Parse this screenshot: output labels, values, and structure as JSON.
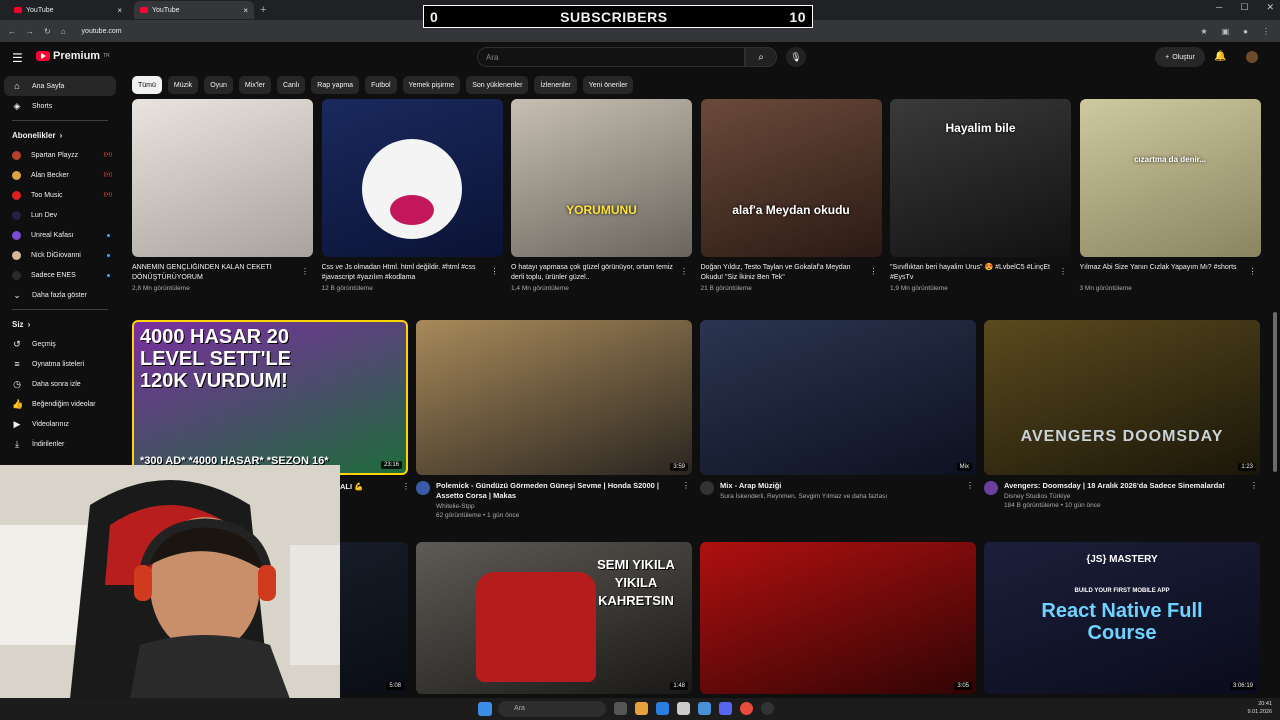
{
  "browser": {
    "tabs": [
      {
        "label": "YouTube"
      },
      {
        "label": "YouTube"
      }
    ],
    "url": "youtube.com"
  },
  "overlay": {
    "left": "0",
    "title": "SUBSCRIBERS",
    "right": "10"
  },
  "masthead": {
    "logo": "Premium",
    "logo_sup": "TR",
    "search_placeholder": "Ara",
    "create_label": "Oluştur"
  },
  "chips": [
    "Tümü",
    "Müzik",
    "Oyun",
    "Mix'ler",
    "Canlı",
    "Rap yapma",
    "Futbol",
    "Yemek pişirme",
    "Son yüklenenler",
    "İzlenenler",
    "Yeni öneriler"
  ],
  "sidebar": {
    "main": [
      {
        "label": "Ana Sayfa",
        "icon": "home-icon"
      },
      {
        "label": "Shorts",
        "icon": "shorts-icon"
      }
    ],
    "subs_heading": "Abonelikler",
    "subs": [
      {
        "label": "Spartan Playzz",
        "color": "#b5402f",
        "badge": "live"
      },
      {
        "label": "Alan Becker",
        "color": "#d9a442",
        "badge": "live"
      },
      {
        "label": "Too Music",
        "color": "#e02020",
        "badge": "live"
      },
      {
        "label": "Lun Dev",
        "color": "#222244",
        "badge": ""
      },
      {
        "label": "Unreal Kafası",
        "color": "#7b4bd1",
        "badge": "dot"
      },
      {
        "label": "Nick DiGiovanni",
        "color": "#d8b89a",
        "badge": "dot"
      },
      {
        "label": "Sadece ENES",
        "color": "#2b2b2b",
        "badge": "dot"
      }
    ],
    "more_label": "Daha fazla göster",
    "you_heading": "Siz",
    "you": [
      {
        "label": "Geçmiş",
        "icon": "history-icon"
      },
      {
        "label": "Oynatma listeleri",
        "icon": "playlist-icon"
      },
      {
        "label": "Daha sonra izle",
        "icon": "clock-icon"
      },
      {
        "label": "Beğendiğim videolar",
        "icon": "like-icon"
      },
      {
        "label": "Videolarınız",
        "icon": "video-icon"
      },
      {
        "label": "İndirilenler",
        "icon": "download-icon"
      }
    ]
  },
  "shorts": [
    {
      "title": "ANNEMİN GENÇLİĞİNDEN KALAN CEKETİ DÖNÜŞTÜRÜYORUM",
      "views": "2,8 Mn görüntüleme",
      "caption": "",
      "color1": "#e9e4df",
      "color2": "#a8a39c"
    },
    {
      "title": "Css ve Js olmadan Html. html değildir. #html #css #javascript #yazılım #kodlama",
      "views": "12 B görüntüleme",
      "caption": "",
      "color1": "#1a2a5e",
      "color2": "#0b1235"
    },
    {
      "title": "O hatayı yapmasa çok güzel görünüyor, ortam temiz derli toplu, ürünler güzel..",
      "views": "1,4 Mn görüntüleme",
      "caption": "YORUMUNU",
      "color1": "#c7bfb3",
      "color2": "#6a655c"
    },
    {
      "title": "Doğan Yıldız, Testo Taylan ve Gokalaf'a Meydan Okudu! \"Siz İkiniz Ben Tek\"",
      "views": "21 B görüntüleme",
      "caption": "alaf'a Meydan okudu",
      "color1": "#6b4a3a",
      "color2": "#2a1a14"
    },
    {
      "title": "\"Sınıflıktan beri hayalim Urus\" 😍 #LvbelC5 #LinçEt #EysTv",
      "views": "1,9 Mn görüntüleme",
      "caption": "Hayalim bile",
      "color1": "#3a3a3a",
      "color2": "#111"
    },
    {
      "title": "Yılmaz Abi Size Yanın Cızlak Yapayım Mı? #shorts",
      "views": "3 Mn görüntüleme",
      "caption": "cızartma da denir...",
      "color1": "#cfc9a0",
      "color2": "#8a8460"
    }
  ],
  "videos_row1": [
    {
      "title": "",
      "channel": "",
      "meta": "",
      "duration": "23:16",
      "color1": "#7b2ea0",
      "color2": "#1e6b3a",
      "thumb_text": "4000 HASAR 20 LEVEL SETT'LE 120K VURDUM!",
      "thumb_sub": "*300 AD* *4000 HASAR* *SEZON 16*"
    },
    {
      "title": "Polemick - Gündüzü Görmeden Güneşi Sevme | Honda S2000 | Assetto Corsa | Makas",
      "channel": "Whitelie-Stpp",
      "meta": "62 görüntüleme • 1 gün önce",
      "duration": "3:59",
      "color1": "#a88a5a",
      "color2": "#2a2520",
      "thumb_text": "",
      "thumb_sub": ""
    },
    {
      "title": "Mix - Arap Müziği",
      "channel": "Sura İskenderli, Reynmen, Sevgim Yılmaz ve daha fazlası",
      "meta": "",
      "duration": "Mix",
      "color1": "#2b3550",
      "color2": "#0d1120",
      "thumb_text": "",
      "thumb_sub": ""
    },
    {
      "title": "Avengers: Doomsday | 18 Aralık 2026'da Sadece Sinemalarda!",
      "channel": "Disney Studios Türkiye",
      "meta": "184 B görüntüleme • 10 gün önce",
      "duration": "1:23",
      "color1": "#5a4a1e",
      "color2": "#1a1608",
      "thumb_text": "AVENGERS DOOMSDAY",
      "thumb_sub": ""
    }
  ],
  "videos_row2": [
    {
      "duration": "5:08",
      "color1": "#1b2230",
      "color2": "#0a0d14",
      "thumb_text": ""
    },
    {
      "duration": "1:48",
      "color1": "#5e5a55",
      "color2": "#1a1917",
      "thumb_text": "SEMI YIKILA YIKILA KAHRETSIN"
    },
    {
      "duration": "3:05",
      "color1": "#b01010",
      "color2": "#300404",
      "thumb_text": ""
    },
    {
      "duration": "3:06:19",
      "color1": "#1b1f3a",
      "color2": "#0a0c1c",
      "thumb_text": "React Native Full Course",
      "thumb_sub": "BUILD YOUR FIRST MOBILE APP",
      "thumb_brand": "{JS} MASTERY"
    }
  ],
  "row1_partial_title": "ALI 💪",
  "taskbar": {
    "search": "Ara",
    "time": "20:41",
    "date": "9.01.2026"
  }
}
